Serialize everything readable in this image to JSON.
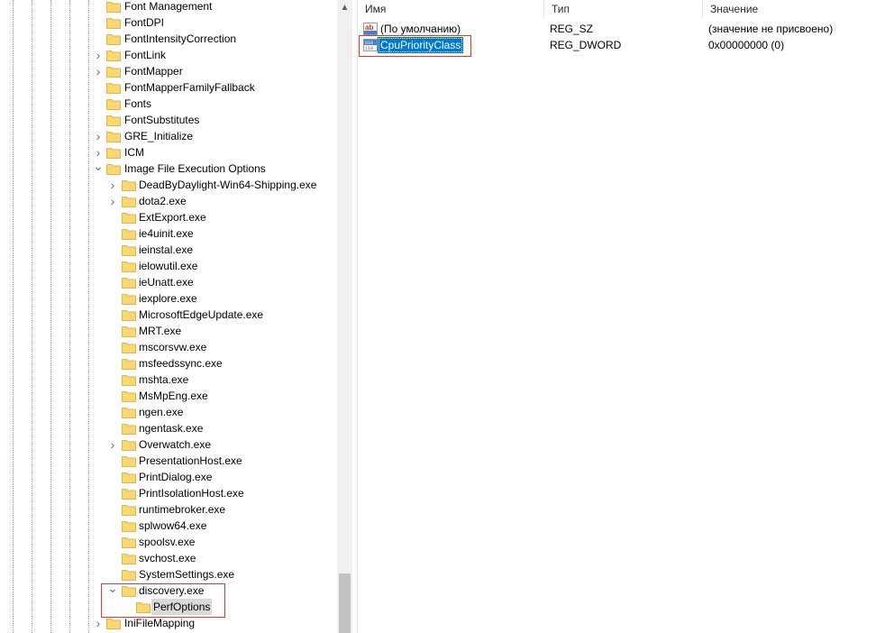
{
  "tree": {
    "items": [
      {
        "label": "Font Management",
        "expander": "none",
        "depth": 1
      },
      {
        "label": "FontDPI",
        "expander": "none",
        "depth": 1
      },
      {
        "label": "FontIntensityCorrection",
        "expander": "none",
        "depth": 1
      },
      {
        "label": "FontLink",
        "expander": "collapsed",
        "depth": 1
      },
      {
        "label": "FontMapper",
        "expander": "collapsed",
        "depth": 1
      },
      {
        "label": "FontMapperFamilyFallback",
        "expander": "none",
        "depth": 1
      },
      {
        "label": "Fonts",
        "expander": "none",
        "depth": 1
      },
      {
        "label": "FontSubstitutes",
        "expander": "none",
        "depth": 1
      },
      {
        "label": "GRE_Initialize",
        "expander": "collapsed",
        "depth": 1
      },
      {
        "label": "ICM",
        "expander": "collapsed",
        "depth": 1
      },
      {
        "label": "Image File Execution Options",
        "expander": "expanded",
        "depth": 1
      },
      {
        "label": "DeadByDaylight-Win64-Shipping.exe",
        "expander": "collapsed",
        "depth": 2
      },
      {
        "label": "dota2.exe",
        "expander": "collapsed",
        "depth": 2
      },
      {
        "label": "ExtExport.exe",
        "expander": "none",
        "depth": 2
      },
      {
        "label": "ie4uinit.exe",
        "expander": "none",
        "depth": 2
      },
      {
        "label": "ieinstal.exe",
        "expander": "none",
        "depth": 2
      },
      {
        "label": "ielowutil.exe",
        "expander": "none",
        "depth": 2
      },
      {
        "label": "ieUnatt.exe",
        "expander": "none",
        "depth": 2
      },
      {
        "label": "iexplore.exe",
        "expander": "none",
        "depth": 2
      },
      {
        "label": "MicrosoftEdgeUpdate.exe",
        "expander": "none",
        "depth": 2
      },
      {
        "label": "MRT.exe",
        "expander": "none",
        "depth": 2
      },
      {
        "label": "mscorsvw.exe",
        "expander": "none",
        "depth": 2
      },
      {
        "label": "msfeedssync.exe",
        "expander": "none",
        "depth": 2
      },
      {
        "label": "mshta.exe",
        "expander": "none",
        "depth": 2
      },
      {
        "label": "MsMpEng.exe",
        "expander": "none",
        "depth": 2
      },
      {
        "label": "ngen.exe",
        "expander": "none",
        "depth": 2
      },
      {
        "label": "ngentask.exe",
        "expander": "none",
        "depth": 2
      },
      {
        "label": "Overwatch.exe",
        "expander": "collapsed",
        "depth": 2
      },
      {
        "label": "PresentationHost.exe",
        "expander": "none",
        "depth": 2
      },
      {
        "label": "PrintDialog.exe",
        "expander": "none",
        "depth": 2
      },
      {
        "label": "PrintIsolationHost.exe",
        "expander": "none",
        "depth": 2
      },
      {
        "label": "runtimebroker.exe",
        "expander": "none",
        "depth": 2
      },
      {
        "label": "splwow64.exe",
        "expander": "none",
        "depth": 2
      },
      {
        "label": "spoolsv.exe",
        "expander": "none",
        "depth": 2
      },
      {
        "label": "svchost.exe",
        "expander": "none",
        "depth": 2
      },
      {
        "label": "SystemSettings.exe",
        "expander": "none",
        "depth": 2
      },
      {
        "label": "discovery.exe",
        "expander": "expanded",
        "depth": 2
      },
      {
        "label": "PerfOptions",
        "expander": "none",
        "depth": 3,
        "selected": true
      },
      {
        "label": "IniFileMapping",
        "expander": "collapsed",
        "depth": 1
      }
    ]
  },
  "values": {
    "headers": {
      "name": "Имя",
      "type": "Тип",
      "data": "Значение"
    },
    "rows": [
      {
        "name": "(По умолчанию)",
        "type": "REG_SZ",
        "data": "(значение не присвоено)",
        "icon": "string-value-icon",
        "selected": false
      },
      {
        "name": "CpuPriorityClass",
        "type": "REG_DWORD",
        "data": "0x00000000 (0)",
        "icon": "dword-value-icon",
        "selected": true
      }
    ]
  },
  "colors": {
    "folder": "#f8d775",
    "folder_dark": "#e0b64a",
    "selection": "#0078d7",
    "highlight_box": "#d9383a"
  }
}
